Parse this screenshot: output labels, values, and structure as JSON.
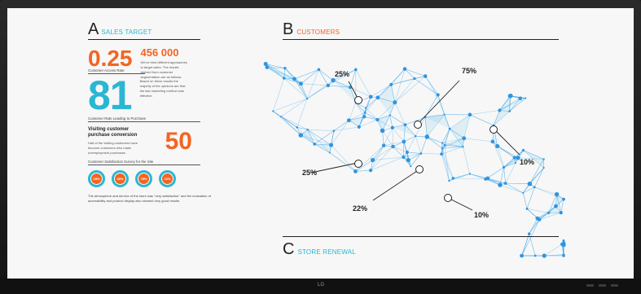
{
  "display": {
    "brand_logo": "LG",
    "accent_teal": "#29b7d3",
    "accent_orange": "#f26522"
  },
  "panel_a": {
    "letter": "A",
    "title": "SALES TARGET",
    "stat_rate": "0.25",
    "stat_count": "456 000",
    "stat_count_desc": "We've tried different approaches to target sales. The results derived from customer segmentation are as follows:",
    "access_rate_label": "Customer Access Rate",
    "access_rate_value": "81",
    "access_rate_desc": "Based on these results the majority of the opinions are that the last marketing method was effective.",
    "purchase_rate_label": "Customer Rate Leading to Purchase",
    "purchase_title": "Visiting customer purchase conversion",
    "purchase_desc": "Half of the visiting customers have become customers who make unemployment purchases.",
    "purchase_value": "50",
    "survey_label": "Customer Satisfaction Survey for the Site",
    "survey": [
      {
        "value": "25%",
        "color": "#f26522"
      },
      {
        "value": "30%",
        "color": "#f26522"
      },
      {
        "value": "75%",
        "color": "#f26522"
      },
      {
        "value": "22%",
        "color": "#f26522"
      }
    ],
    "footer": "The atmosphere and service of the store was \"very satisfaction\" and the evaluation of accessibility and product display also showed very good results."
  },
  "panel_b": {
    "letter": "B",
    "title": "CUSTOMERS",
    "callouts": [
      "25%",
      "75%",
      "10%",
      "25%",
      "22%",
      "10%"
    ]
  },
  "panel_c": {
    "letter": "C",
    "title": "STORE RENEWAL"
  }
}
